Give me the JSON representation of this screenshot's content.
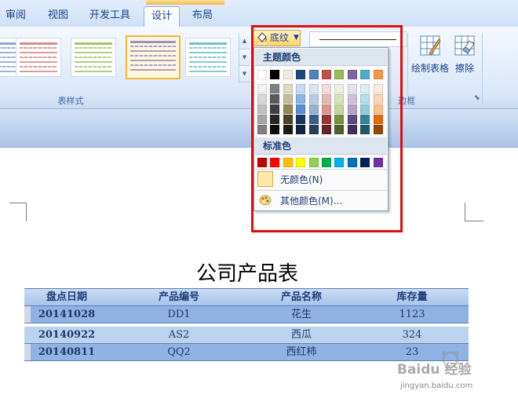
{
  "tabs": [
    {
      "label": "审阅",
      "active": false
    },
    {
      "label": "视图",
      "active": false
    },
    {
      "label": "开发工具",
      "active": false
    },
    {
      "label": "设计",
      "active": true
    },
    {
      "label": "布局",
      "active": false
    }
  ],
  "ribbon": {
    "table_styles_label": "表样式",
    "borders_label": "边框",
    "shading_label": "底纹",
    "draw_table_label": "绘制表格",
    "eraser_label": "擦除"
  },
  "dropdown": {
    "theme_colors_label": "主题颜色",
    "standard_colors_label": "标准色",
    "no_color_label": "无颜色(N)",
    "more_colors_label": "其他颜色(M)..."
  },
  "colors": {
    "theme_top": [
      "#ffffff",
      "#000000",
      "#eeece1",
      "#1f497d",
      "#4f81bd",
      "#c0504d",
      "#9bbb59",
      "#8064a2",
      "#4bacc6",
      "#f79646"
    ],
    "theme_shades": [
      [
        "#f2f2f2",
        "#d8d8d8",
        "#bfbfbf",
        "#a5a5a5",
        "#7f7f7f"
      ],
      [
        "#7f7f7f",
        "#595959",
        "#3f3f3f",
        "#262626",
        "#0c0c0c"
      ],
      [
        "#ddd9c3",
        "#c4bd97",
        "#938953",
        "#494429",
        "#1d1b10"
      ],
      [
        "#c6d9f0",
        "#8db3e2",
        "#548dd4",
        "#17365d",
        "#0f243e"
      ],
      [
        "#dbe5f1",
        "#b8cce4",
        "#95b3d7",
        "#366092",
        "#244061"
      ],
      [
        "#f2dcdb",
        "#e5b9b7",
        "#d99694",
        "#953734",
        "#632423"
      ],
      [
        "#ebf1dd",
        "#d7e3bc",
        "#c3d69b",
        "#76923c",
        "#4f6128"
      ],
      [
        "#e5e0ec",
        "#ccc1d9",
        "#b2a2c7",
        "#5f497a",
        "#3f3151"
      ],
      [
        "#dbeef3",
        "#b7dde8",
        "#92cddc",
        "#31859b",
        "#205867"
      ],
      [
        "#fdeada",
        "#fbd5b5",
        "#fac08f",
        "#e36c09",
        "#974806"
      ]
    ],
    "standard": [
      "#c00000",
      "#ff0000",
      "#ffc000",
      "#ffff00",
      "#92d050",
      "#00b050",
      "#00b0f0",
      "#0070c0",
      "#002060",
      "#7030a0"
    ],
    "highlight": "#e00d0d"
  },
  "document": {
    "title": "公司产品表",
    "table": {
      "headers": [
        "盘点日期",
        "产品编号",
        "产品名称",
        "库存量"
      ],
      "rows": [
        [
          "20141028",
          "DD1",
          "花生",
          "1123"
        ],
        [
          "20140922",
          "AS2",
          "西瓜",
          "324"
        ],
        [
          "20140811",
          "QQ2",
          "西红柿",
          "23"
        ]
      ]
    }
  },
  "watermark": {
    "brand": "Baidu 经验",
    "url": "jingyan.baidu.com"
  }
}
